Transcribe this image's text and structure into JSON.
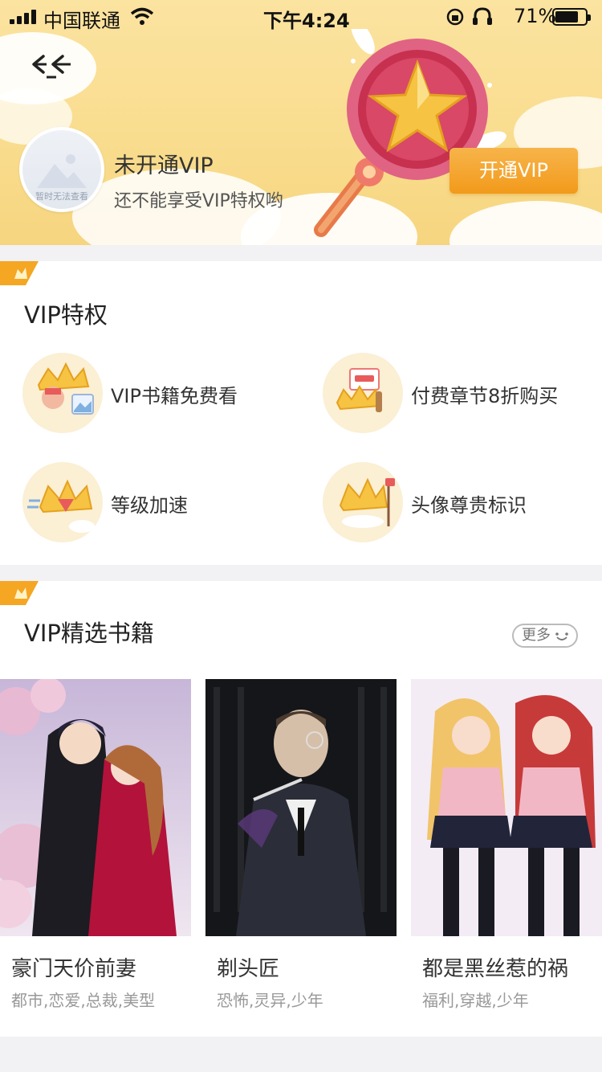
{
  "status_bar": {
    "carrier": "中国联通",
    "time": "下午4:24",
    "battery": "71%"
  },
  "header": {
    "avatar_placeholder": "暂时无法查看",
    "vip_status": "未开通VIP",
    "vip_subtitle": "还不能享受VIP特权哟",
    "open_button": "开通VIP"
  },
  "privileges": {
    "title": "VIP特权",
    "items": [
      {
        "label": "VIP书籍免费看",
        "icon": "crown-book-icon"
      },
      {
        "label": "付费章节8折购买",
        "icon": "crown-discount-icon"
      },
      {
        "label": "等级加速",
        "icon": "crown-speed-icon"
      },
      {
        "label": "头像尊贵标识",
        "icon": "crown-avatar-icon"
      }
    ]
  },
  "books": {
    "title": "VIP精选书籍",
    "more": "更多",
    "items": [
      {
        "title": "豪门天价前妻",
        "tags": "都市,恋爱,总裁,美型"
      },
      {
        "title": "剃头匠",
        "tags": "恐怖,灵异,少年"
      },
      {
        "title": "都是黑丝惹的祸",
        "tags": "福利,穿越,少年"
      }
    ]
  },
  "colors": {
    "accent": "#f29a1b",
    "header_bg": "#f9dd8f"
  }
}
